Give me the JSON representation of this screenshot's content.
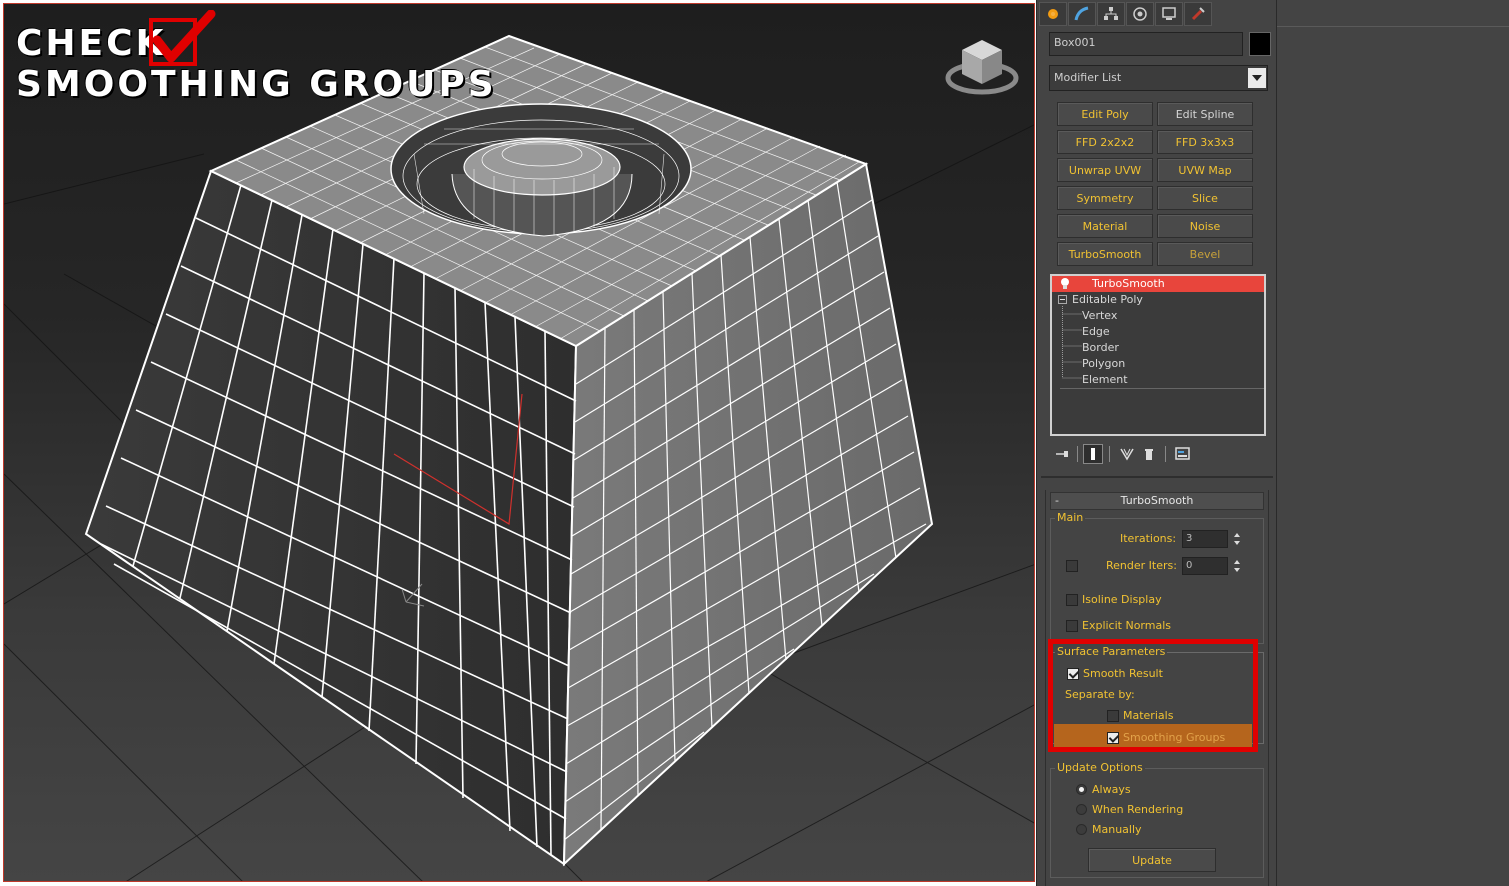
{
  "overlay": {
    "title_line1": "CHECK",
    "title_line2": "SMOOTHING GROUPS",
    "check_icon": "red-check-box-icon",
    "accent_color": "#e00000"
  },
  "viewport": {
    "viewcube_icon": "viewcube-icon",
    "border_color": "#c0392b"
  },
  "command_panel": {
    "tabs": [
      "create-tab-icon",
      "modify-tab-icon",
      "hierarchy-tab-icon",
      "motion-tab-icon",
      "display-tab-icon",
      "utilities-tab-icon"
    ],
    "object_name": "Box001",
    "modifier_list": "Modifier List",
    "modifier_buttons": [
      [
        "Edit Poly",
        "Edit Spline"
      ],
      [
        "FFD 2x2x2",
        "FFD 3x3x3"
      ],
      [
        "Unwrap UVW",
        "UVW Map"
      ],
      [
        "Symmetry",
        "Slice"
      ],
      [
        "Material",
        "Noise"
      ],
      [
        "TurboSmooth",
        "Bevel"
      ]
    ],
    "stack": {
      "turbosmooth": "TurboSmooth",
      "editable_poly": "Editable Poly",
      "sub_objects": [
        "Vertex",
        "Edge",
        "Border",
        "Polygon",
        "Element"
      ]
    }
  },
  "turbosmooth": {
    "rollout_title": "TurboSmooth",
    "collapse_symbol": "-",
    "main": {
      "group_title": "Main",
      "iterations_label": "Iterations:",
      "iterations_value": "3",
      "render_iters_label": "Render Iters:",
      "render_iters_value": "0",
      "isoline_display": "Isoline Display",
      "explicit_normals": "Explicit Normals"
    },
    "surface": {
      "group_title": "Surface Parameters",
      "smooth_result": "Smooth Result",
      "separate_by": "Separate by:",
      "materials": "Materials",
      "smoothing_groups": "Smoothing Groups",
      "highlight_color": "#b5651d"
    },
    "update": {
      "group_title": "Update Options",
      "always": "Always",
      "when_rendering": "When Rendering",
      "manually": "Manually",
      "update_button": "Update"
    }
  }
}
